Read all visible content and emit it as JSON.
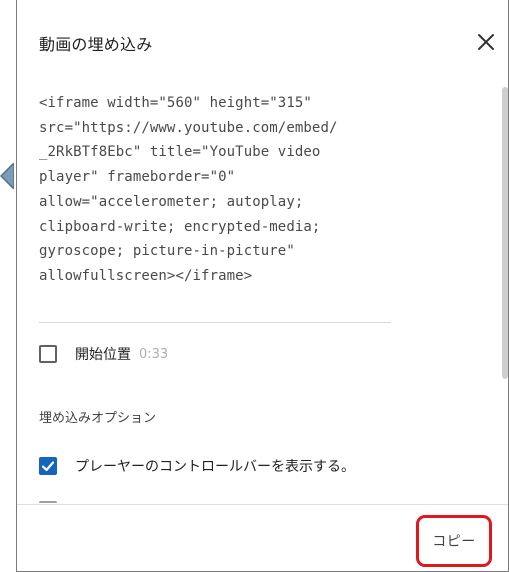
{
  "dialog": {
    "title": "動画の埋め込み",
    "close_icon": "close-icon"
  },
  "embed_code": "<iframe width=\"560\" height=\"315\"\nsrc=\"https://www.youtube.com/embed/\n_2RkBTf8Ebc\" title=\"YouTube video\nplayer\" frameborder=\"0\"\nallow=\"accelerometer; autoplay;\nclipboard-write; encrypted-media;\ngyroscope; picture-in-picture\"\nallowfullscreen></iframe>",
  "start_at": {
    "label": "開始位置",
    "time": "0:33",
    "checked": false
  },
  "options": {
    "heading": "埋め込みオプション",
    "items": [
      {
        "label": "プレーヤーのコントロールバーを表示する。",
        "checked": true
      },
      {
        "label": "",
        "checked": false
      }
    ]
  },
  "footer": {
    "copy_label": "コピー",
    "highlight_color": "#e0171c"
  },
  "colors": {
    "checkbox_checked": "#1565c0",
    "start_time": "#aeaeae"
  }
}
